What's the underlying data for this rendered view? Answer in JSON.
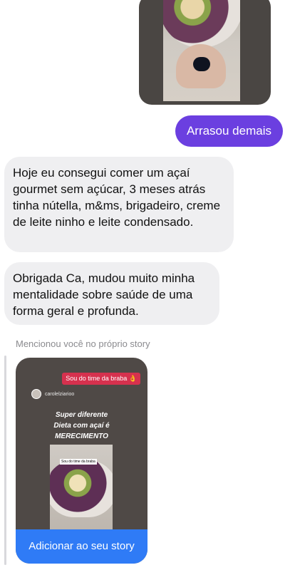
{
  "messages": {
    "outgoing_1": "Arrasou demais",
    "incoming_1": "Hoje eu consegui comer um açaí gourmet sem açúcar, 3 meses atrás tinha nútella, m&ms, brigadeiro, creme de leite ninho e leite condensado.",
    "incoming_2": "Obrigada Ca, mudou muito minha mentalidade sobre saúde de uma forma geral e profunda."
  },
  "mention": {
    "label": "Mencionou você no próprio story",
    "story": {
      "sticker": "Sou do time da braba 👌",
      "username": "carolelziarioo",
      "caption_line1": "Super diferente",
      "caption_line2": "Dieta com açaí é",
      "caption_line3": "MERECIMENTO",
      "inner_sticker": "Sou do time da braba",
      "button": "Adicionar ao seu story"
    }
  },
  "colors": {
    "outgoing_bubble": "#6b3fe0",
    "incoming_bubble": "#efeff1",
    "story_button": "#2f7bf6",
    "sticker": "#d6314e"
  }
}
